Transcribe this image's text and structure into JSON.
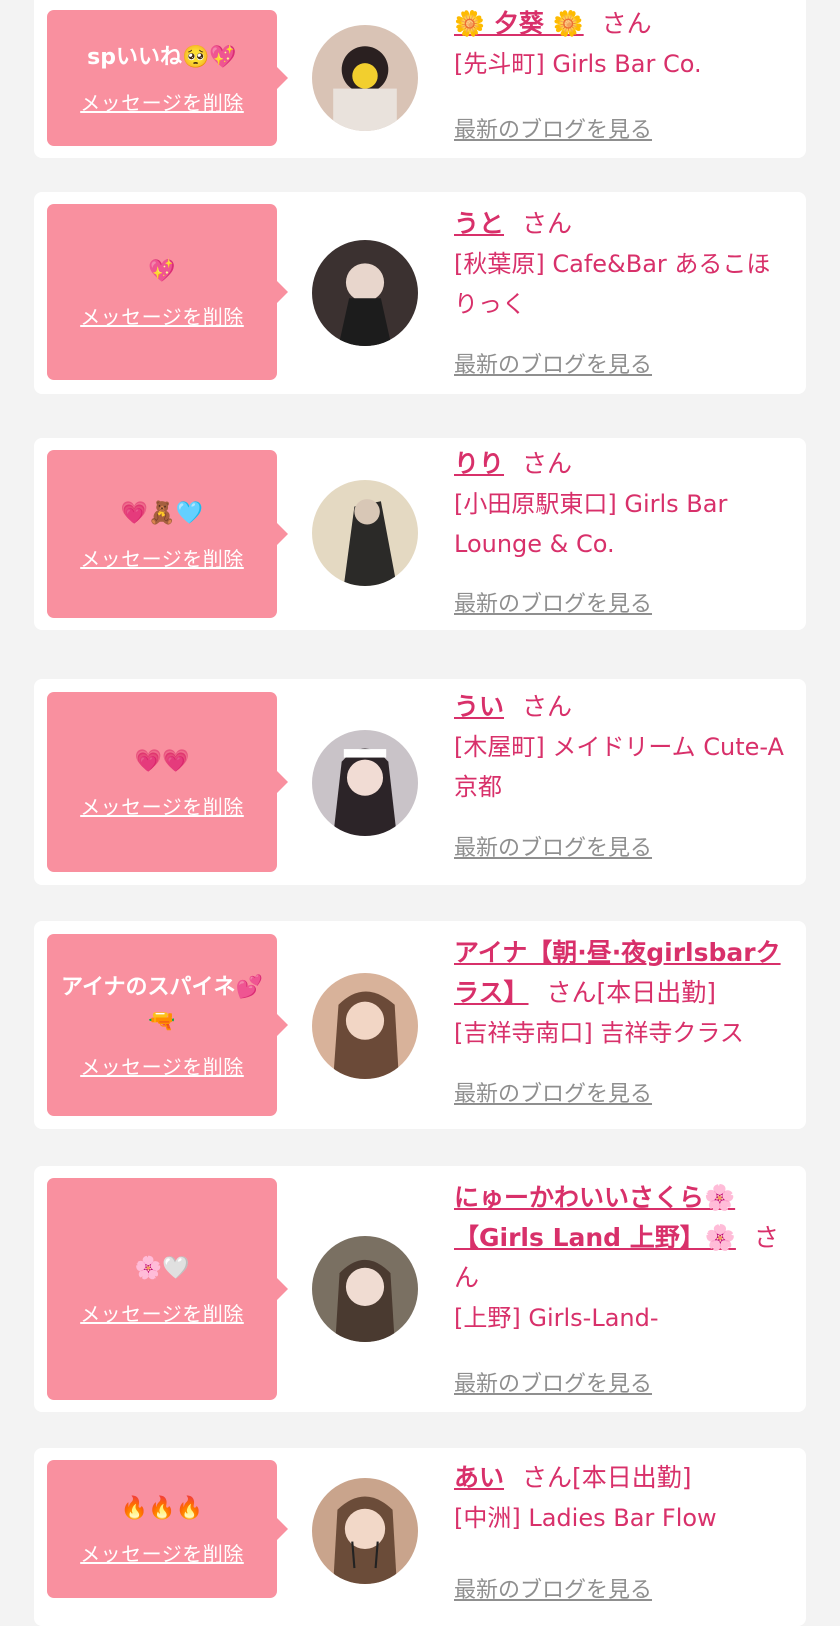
{
  "delete_label": "メッセージを削除",
  "blog_label": "最新のブログを見る",
  "san_label": "さん",
  "entries": [
    {
      "message": "spいいね🥺💖",
      "name": "🌼 夕葵 🌼",
      "status": "",
      "shop": "[先斗町] Girls Bar Co.",
      "avatar_icon": "profile-photo"
    },
    {
      "message": "💖",
      "name": "うと",
      "status": "",
      "shop": "[秋葉原] Cafe&Bar あるこほりっく",
      "avatar_icon": "profile-photo"
    },
    {
      "message": "💗🧸🩵",
      "name": "りり",
      "status": "",
      "shop": "[小田原駅東口] Girls Bar Lounge & Co.",
      "avatar_icon": "profile-photo"
    },
    {
      "message": "💗💗",
      "name": "うい",
      "status": "",
      "shop": "[木屋町] メイドリーム Cute-A 京都",
      "avatar_icon": "profile-photo"
    },
    {
      "message": "アイナのスパイネ💕🔫",
      "name": "アイナ【朝·昼·夜girlsbarクラス】",
      "status": "[本日出勤]",
      "shop": "[吉祥寺南口] 吉祥寺クラス",
      "avatar_icon": "profile-photo"
    },
    {
      "message": "🌸🤍",
      "name": "にゅーかわいいさくら🌸【Girls Land 上野】🌸",
      "status": "",
      "shop": "[上野] Girls-Land-",
      "avatar_icon": "profile-photo"
    },
    {
      "message": "🔥🔥🔥",
      "name": "あい",
      "status": "[本日出勤]",
      "shop": "[中洲] Ladies Bar Flow",
      "avatar_icon": "profile-photo"
    }
  ],
  "colors": {
    "accent": "#d8306a",
    "bubble": "#f9909f",
    "card": "#ffffff",
    "background": "#f3f3f3",
    "link_gray": "#8f8f8f"
  }
}
